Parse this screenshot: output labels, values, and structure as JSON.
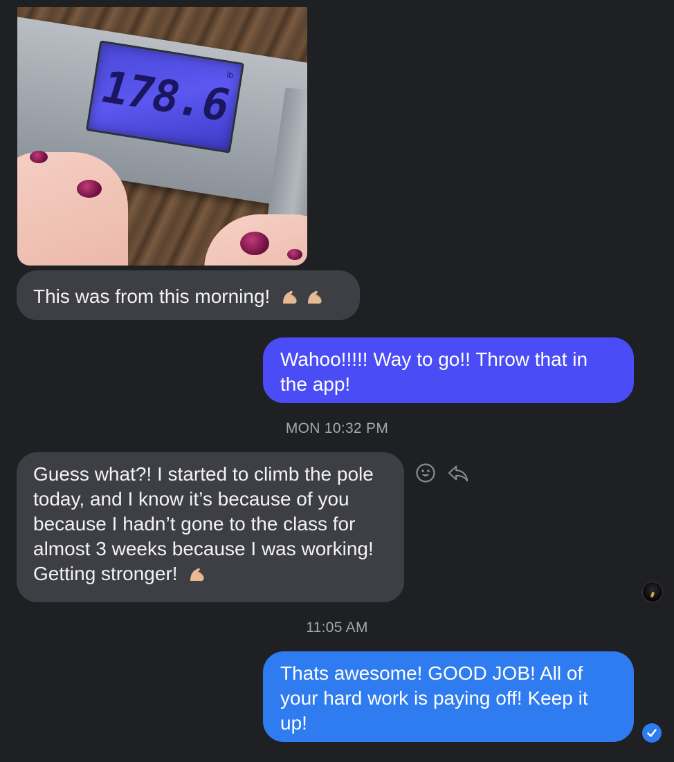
{
  "colors": {
    "background": "#1f2023",
    "incoming_bubble": "#3e3f44",
    "outgoing_purple": "#4a4cf5",
    "outgoing_blue": "#2f7bf0",
    "timestamp": "#a6a8ad"
  },
  "messages": [
    {
      "sender": "them",
      "type": "photo",
      "photo": {
        "reading": "178.6",
        "unit": "lb"
      }
    },
    {
      "sender": "them",
      "type": "text",
      "text": "This was from this morning!",
      "emoji": "flexed-biceps-icon x2"
    },
    {
      "sender": "me",
      "type": "text",
      "text": "Wahoo!!!!! Way to go!! Throw that in the app!"
    },
    {
      "type": "timestamp",
      "text": "MON 10:32 PM"
    },
    {
      "sender": "them",
      "type": "text",
      "text": "Guess what?! I started to climb the pole today, and I know it’s because of you because I hadn’t gone to the class for almost 3 weeks because I was working! Getting stronger!",
      "emoji": "flexed-biceps-icon"
    },
    {
      "type": "timestamp",
      "text": "11:05 AM"
    },
    {
      "sender": "me",
      "type": "text",
      "text": "Thats awesome! GOOD JOB! All of your hard work is paying off! Keep it up!",
      "status": "read-receipt-check-icon"
    }
  ],
  "message_actions": {
    "react_icon": "smiley-face-icon",
    "reply_icon": "reply-arrow-icon"
  }
}
